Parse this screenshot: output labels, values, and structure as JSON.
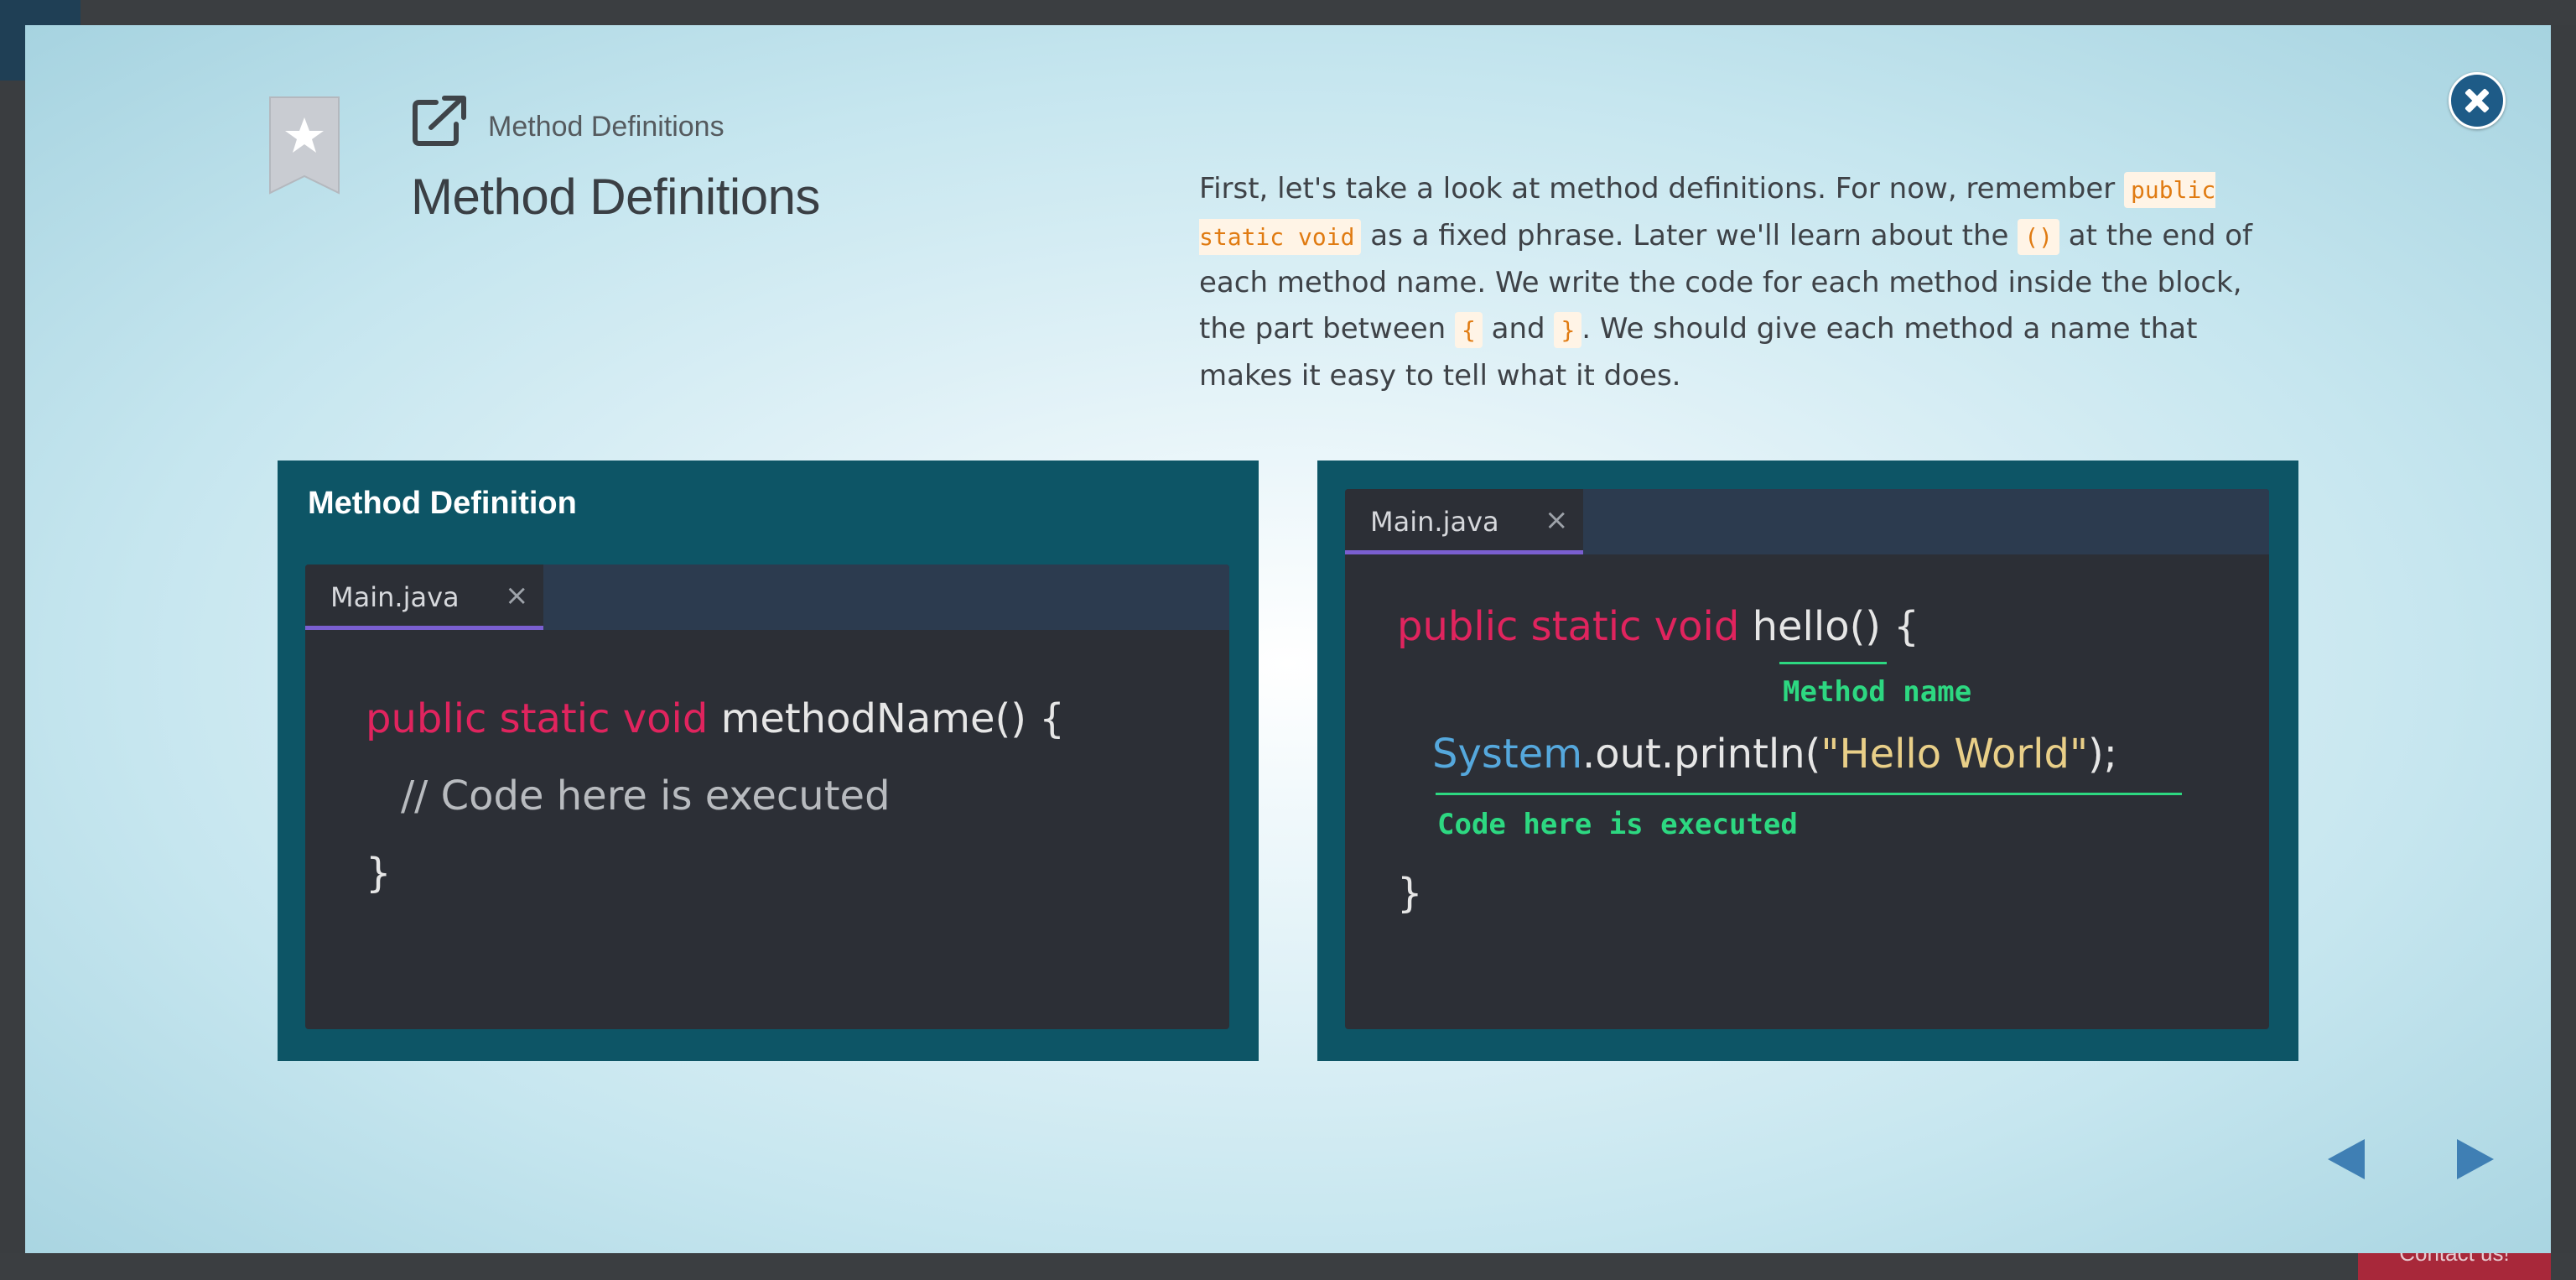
{
  "background": {
    "contact_label": "Contact us!"
  },
  "header": {
    "breadcrumb": "Method Definitions",
    "title": "Method Definitions"
  },
  "description": {
    "t1": "First, let's take a look at method definitions. For now, remember ",
    "c1": "public static void",
    "t2": " as a fixed phrase. Later we'll learn about the ",
    "c2": "()",
    "t3": " at the end of each method name. We write the code for each method inside the block, the part between ",
    "c3": "{",
    "t4": " and ",
    "c4": "}",
    "t5": ". We should give each method a name that makes it easy to tell what it does."
  },
  "left_panel": {
    "title": "Method Definition",
    "tab_label": "Main.java",
    "tab_close": "×",
    "line1_kw": "public static void ",
    "line1_rest": "methodName() {",
    "line2": "// Code here is executed",
    "line3": "}"
  },
  "right_panel": {
    "tab_label": "Main.java",
    "tab_close": "×",
    "line1_kw": "public static void ",
    "line1_name": "hello",
    "line1_rest": "() {",
    "annot1": "Method name",
    "line2_sys": "System",
    "line2_mid": ".out.println(",
    "line2_str": "\"Hello World\"",
    "line2_end": ");",
    "annot2": "Code here is executed",
    "line3": "}"
  },
  "colors": {
    "panel": "#0d5566",
    "editor": "#2c2f36",
    "keyword": "#e0245e",
    "annotation": "#2dd881",
    "nav": "#3f7fb4"
  }
}
